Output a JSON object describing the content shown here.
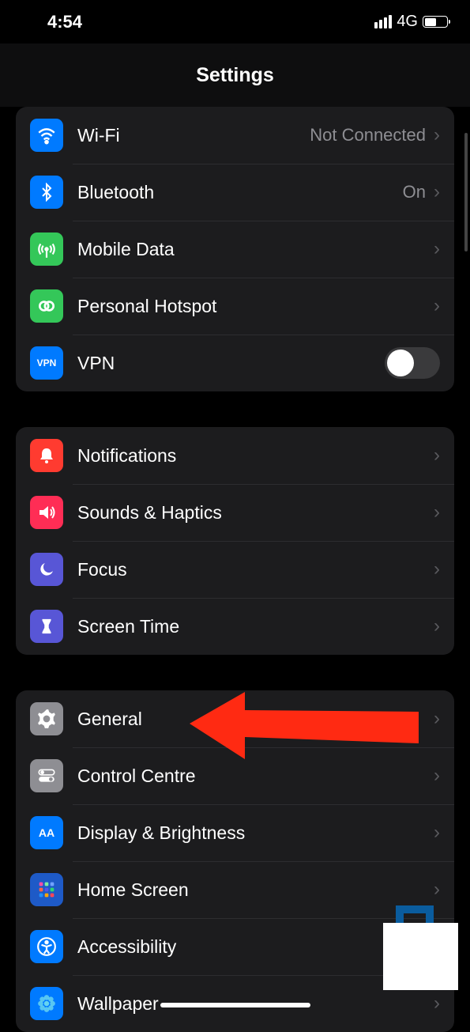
{
  "status": {
    "time": "4:54",
    "network": "4G"
  },
  "header": {
    "title": "Settings"
  },
  "groups": [
    {
      "rows": [
        {
          "key": "wifi",
          "label": "Wi-Fi",
          "value": "Not Connected",
          "iconColor": "ic-blue",
          "iconName": "wifi-icon",
          "chevron": true
        },
        {
          "key": "bluetooth",
          "label": "Bluetooth",
          "value": "On",
          "iconColor": "ic-blue",
          "iconName": "bluetooth-icon",
          "chevron": true
        },
        {
          "key": "mobiledata",
          "label": "Mobile Data",
          "value": "",
          "iconColor": "ic-green",
          "iconName": "antenna-icon",
          "chevron": true
        },
        {
          "key": "hotspot",
          "label": "Personal Hotspot",
          "value": "",
          "iconColor": "ic-green",
          "iconName": "hotspot-icon",
          "chevron": true
        },
        {
          "key": "vpn",
          "label": "VPN",
          "value": "",
          "iconColor": "ic-blue",
          "iconName": "vpn-icon",
          "iconText": "VPN",
          "toggle": true,
          "toggleOn": false
        }
      ]
    },
    {
      "rows": [
        {
          "key": "notifications",
          "label": "Notifications",
          "iconColor": "ic-red",
          "iconName": "bell-icon",
          "chevron": true
        },
        {
          "key": "sounds",
          "label": "Sounds & Haptics",
          "iconColor": "ic-pink",
          "iconName": "speaker-icon",
          "chevron": true
        },
        {
          "key": "focus",
          "label": "Focus",
          "iconColor": "ic-indigo",
          "iconName": "moon-icon",
          "chevron": true
        },
        {
          "key": "screentime",
          "label": "Screen Time",
          "iconColor": "ic-indigo",
          "iconName": "hourglass-icon",
          "chevron": true
        }
      ]
    },
    {
      "rows": [
        {
          "key": "general",
          "label": "General",
          "iconColor": "ic-gray",
          "iconName": "gear-icon",
          "chevron": true
        },
        {
          "key": "controlcentre",
          "label": "Control Centre",
          "iconColor": "ic-gray",
          "iconName": "switches-icon",
          "chevron": true
        },
        {
          "key": "display",
          "label": "Display & Brightness",
          "iconColor": "ic-blue",
          "iconName": "text-size-icon",
          "iconText": "AA",
          "chevron": true
        },
        {
          "key": "homescreen",
          "label": "Home Screen",
          "iconColor": "ic-darkblue",
          "iconName": "grid-icon",
          "chevron": true
        },
        {
          "key": "accessibility",
          "label": "Accessibility",
          "iconColor": "ic-blue",
          "iconName": "accessibility-icon",
          "chevron": true
        },
        {
          "key": "wallpaper",
          "label": "Wallpaper",
          "iconColor": "ic-blue",
          "iconName": "flower-icon",
          "chevron": true
        }
      ]
    }
  ],
  "annotation": {
    "pointsTo": "general"
  }
}
